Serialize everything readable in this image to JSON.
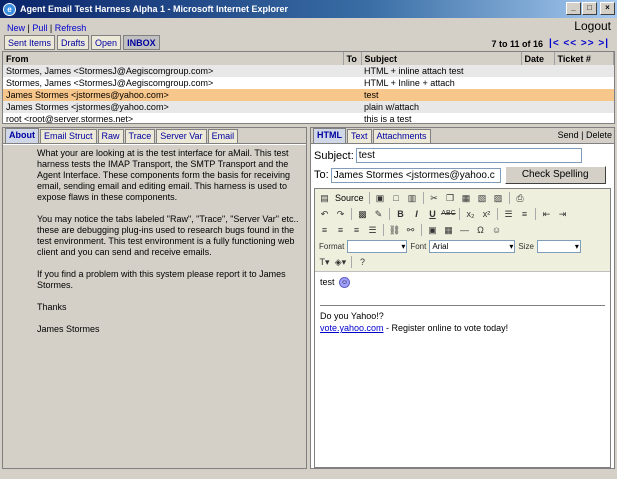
{
  "window": {
    "title": "Agent Email Test Harness Alpha 1 - Microsoft Internet Explorer"
  },
  "top_links": {
    "new": "New",
    "pull": "Pull",
    "refresh": "Refresh",
    "sep": "|"
  },
  "logout": "Logout",
  "folders": [
    "Sent Items",
    "Drafts",
    "Open",
    "INBOX"
  ],
  "paging": {
    "count": "7 to 11 of 16",
    "nav": "|< << >> >|"
  },
  "message_list": {
    "columns": [
      "From",
      "To",
      "Subject",
      "Date",
      "Ticket #"
    ],
    "rows": [
      {
        "from": "Stormes, James <StormesJ@Aegiscomgroup.com>",
        "to": "",
        "subject": "HTML + inline attach test",
        "date": "",
        "ticket": ""
      },
      {
        "from": "Stormes, James <StormesJ@Aegiscomgroup.com>",
        "to": "",
        "subject": "HTML + Inline + attach",
        "date": "",
        "ticket": ""
      },
      {
        "from": "James Stormes <jstormes@yahoo.com>",
        "to": "",
        "subject": "test",
        "date": "",
        "ticket": ""
      },
      {
        "from": "James Stormes <jstormes@yahoo.com>",
        "to": "",
        "subject": "plain w/attach",
        "date": "",
        "ticket": ""
      },
      {
        "from": "root <root@server.stormes.net>",
        "to": "",
        "subject": "this is a test",
        "date": "",
        "ticket": ""
      }
    ]
  },
  "left_tabs": [
    "About",
    "Email Struct",
    "Raw",
    "Trace",
    "Server Var",
    "Email"
  ],
  "about_text": [
    "What your are looking at is the test interface for aMail.  This test harness tests the IMAP Transport, the SMTP Transport and the Agent Interface.  These components form the basis for receiving email, sending email and editing email.  This harness is used to expose flaws in these components.",
    "You may notice the tabs labeled \"Raw\", \"Trace\", \"Server Var\" etc..  these are debugging plug-ins used to research bugs found in the test environment.  This test environment is a fully functioning web client and you can send and receive emails.",
    "If you find a problem with this system please report it to James Stormes.",
    "Thanks",
    "James Stormes"
  ],
  "right_tabs": [
    "HTML",
    "Text",
    "Attachments"
  ],
  "right_actions": "Send | Delete",
  "composer": {
    "subject_label": "Subject:",
    "subject_value": "test",
    "to_label": "To:",
    "to_value": "James Stormes <jstormes@yahoo.c",
    "spell_button": "Check Spelling",
    "source_label": "Source",
    "format_label": "Format",
    "font_label": "Font",
    "font_value": "Arial",
    "size_label": "Size",
    "body_text": "test",
    "sig_line1": "Do you Yahoo!?",
    "sig_link": "vote.yahoo.com",
    "sig_rest": " - Register online to vote today!"
  }
}
